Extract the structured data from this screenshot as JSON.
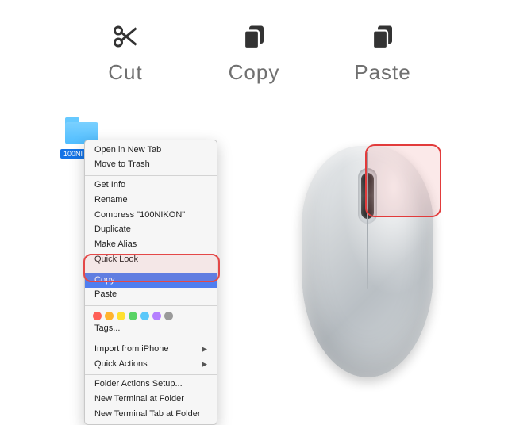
{
  "toolbar": {
    "cut": {
      "label": "Cut",
      "icon": "scissors-icon"
    },
    "copy": {
      "label": "Copy",
      "icon": "copy-icon"
    },
    "paste": {
      "label": "Paste",
      "icon": "paste-icon"
    }
  },
  "folder": {
    "name": "100NIKON",
    "label_truncated": "100NI"
  },
  "context_menu": {
    "groups": [
      [
        {
          "label": "Open in New Tab"
        },
        {
          "label": "Move to Trash"
        }
      ],
      [
        {
          "label": "Get Info"
        },
        {
          "label": "Rename"
        },
        {
          "label": "Compress \"100NIKON\""
        },
        {
          "label": "Duplicate"
        },
        {
          "label": "Make Alias"
        },
        {
          "label": "Quick Look"
        }
      ],
      [
        {
          "label": "Copy",
          "highlighted": true
        },
        {
          "label": "Paste"
        }
      ],
      [
        {
          "tags_label": "Tags..."
        }
      ],
      [
        {
          "label": "Import from iPhone",
          "submenu": true
        },
        {
          "label": "Quick Actions",
          "submenu": true
        }
      ],
      [
        {
          "label": "Folder Actions Setup..."
        },
        {
          "label": "New Terminal at Folder"
        },
        {
          "label": "New Terminal Tab at Folder"
        }
      ]
    ],
    "tag_colors": [
      "#ff5f57",
      "#ffb32e",
      "#ffe030",
      "#58d364",
      "#5ac8fa",
      "#b580ff",
      "#9a9a9a"
    ]
  },
  "annotations": {
    "menu_highlight_items": [
      "Copy",
      "Paste"
    ],
    "mouse_highlight": "right-click-area"
  },
  "mouse": {
    "device": "computer-mouse",
    "highlighted_button": "right"
  }
}
